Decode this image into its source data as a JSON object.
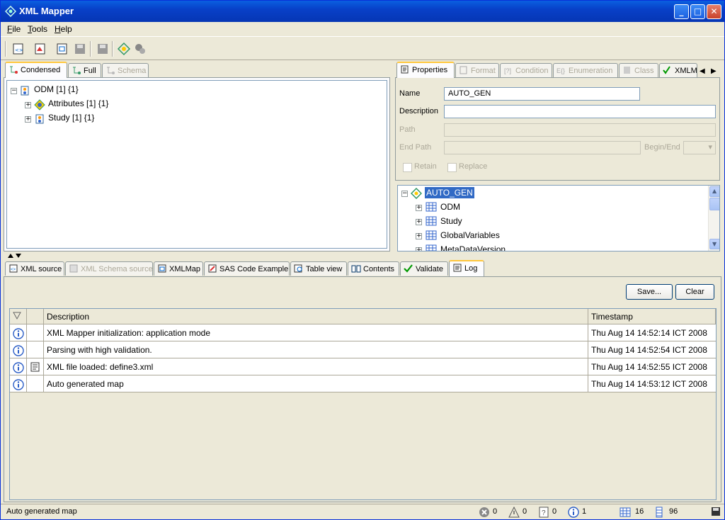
{
  "window": {
    "title": "XML Mapper"
  },
  "menu": {
    "file": "File",
    "file_key": "F",
    "file_rest": "ile",
    "tools_key": "T",
    "tools_rest": "ools",
    "help_key": "H",
    "help_rest": "elp"
  },
  "left_tabs": {
    "condensed": "Condensed",
    "full": "Full",
    "schema": "Schema"
  },
  "left_tree": [
    {
      "label": "ODM [1] {1}"
    },
    {
      "label": "Attributes [1] {1}"
    },
    {
      "label": "Study [1] {1}"
    }
  ],
  "right_tabs": {
    "properties": "Properties",
    "format": "Format",
    "condition": "Condition",
    "enumeration": "Enumeration",
    "class": "Class",
    "xmlm": "XMLM"
  },
  "properties": {
    "name_label": "Name",
    "name_value": "AUTO_GEN",
    "description_label": "Description",
    "description_value": "",
    "path_label": "Path",
    "endpath_label": "End Path",
    "beginend_label": "Begin/End",
    "retain_label": "Retain",
    "replace_label": "Replace"
  },
  "right_tree": [
    {
      "label": "AUTO_GEN"
    },
    {
      "label": "ODM"
    },
    {
      "label": "Study"
    },
    {
      "label": "GlobalVariables"
    },
    {
      "label": "MetaDataVersion"
    }
  ],
  "bottom_tabs": {
    "xml_source": "XML source",
    "schema_source": "XML Schema source",
    "xmlmap": "XMLMap",
    "sas_code": "SAS Code Example",
    "table_view": "Table view",
    "contents": "Contents",
    "validate": "Validate",
    "log": "Log"
  },
  "log": {
    "save_label": "Save...",
    "clear_label": "Clear",
    "headers": {
      "description": "Description",
      "timestamp": "Timestamp"
    },
    "rows": [
      {
        "description": "XML Mapper initialization: application mode",
        "timestamp": "Thu Aug 14 14:52:14 ICT 2008",
        "icon": "info-icon"
      },
      {
        "description": "Parsing with high validation.",
        "timestamp": "Thu Aug 14 14:52:54 ICT 2008",
        "icon": "info-icon"
      },
      {
        "description": "XML file loaded: define3.xml",
        "timestamp": "Thu Aug 14 14:52:55 ICT 2008",
        "icon": "info-icon"
      },
      {
        "description": "Auto generated map",
        "timestamp": "Thu Aug 14 14:53:12 ICT 2008",
        "icon": "info-icon"
      }
    ]
  },
  "status": {
    "message": "Auto generated map",
    "errors": "0",
    "warnings": "0",
    "questions": "0",
    "infos": "1",
    "tables": "16",
    "columns": "96"
  }
}
